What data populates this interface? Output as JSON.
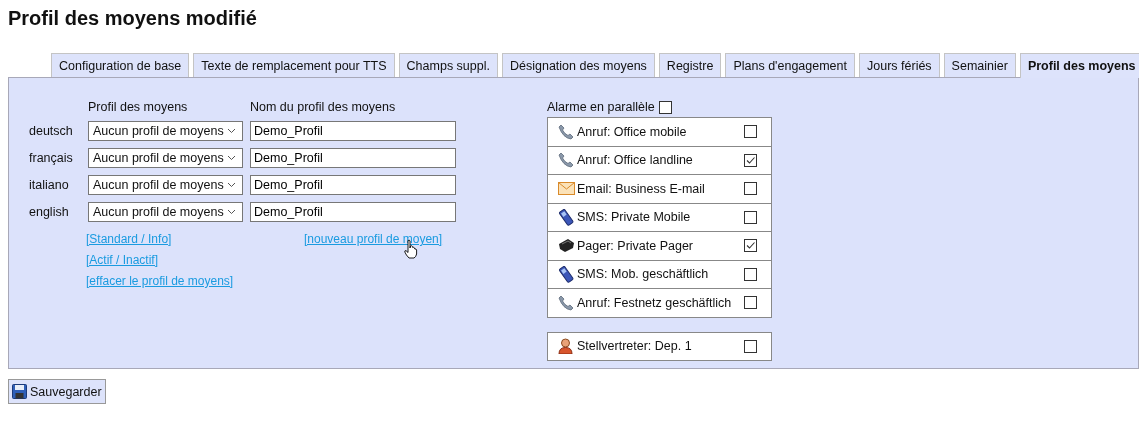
{
  "title": "Profil des moyens modifié",
  "tabs": [
    {
      "label": "Configuration de base",
      "selected": false
    },
    {
      "label": "Texte de remplacement pour TTS",
      "selected": false
    },
    {
      "label": "Champs suppl.",
      "selected": false
    },
    {
      "label": "Désignation des moyens",
      "selected": false
    },
    {
      "label": "Registre",
      "selected": false
    },
    {
      "label": "Plans d'engagement",
      "selected": false
    },
    {
      "label": "Jours fériés",
      "selected": false
    },
    {
      "label": "Semainier",
      "selected": false
    },
    {
      "label": "Profil des moyens",
      "selected": true
    }
  ],
  "profiles": {
    "column_headers": [
      "Profil des moyens",
      "Nom du profil des moyens"
    ],
    "rows": [
      {
        "language": "deutsch",
        "profile": "Aucun profil de moyens",
        "name": "Demo_Profil"
      },
      {
        "language": "français",
        "profile": "Aucun profil de moyens",
        "name": "Demo_Profil"
      },
      {
        "language": "italiano",
        "profile": "Aucun profil de moyens",
        "name": "Demo_Profil"
      },
      {
        "language": "english",
        "profile": "Aucun profil de moyens",
        "name": "Demo_Profil"
      }
    ],
    "left_links": [
      "[Standard / Info]",
      "[Actif / Inactif]",
      "[effacer le profil de moyens]"
    ],
    "new_link": "[nouveau profil de moyen]"
  },
  "parallel_alarm": {
    "label": "Alarme en parallèle",
    "checked": false
  },
  "media": [
    {
      "kind": "phone",
      "label": "Anruf: Office mobile",
      "checked": false
    },
    {
      "kind": "phone",
      "label": "Anruf: Office landline",
      "checked": true
    },
    {
      "kind": "email",
      "label": "Email: Business E-mail",
      "checked": false
    },
    {
      "kind": "mobile",
      "label": "SMS: Private Mobile",
      "checked": false
    },
    {
      "kind": "pager",
      "label": "Pager: Private Pager",
      "checked": true
    },
    {
      "kind": "mobile",
      "label": "SMS: Mob. geschäftlich",
      "checked": false
    },
    {
      "kind": "phone",
      "label": "Anruf: Festnetz geschäftlich",
      "checked": false
    }
  ],
  "deputies": [
    {
      "kind": "person",
      "label": "Stellvertreter: Dep. 1",
      "checked": false
    }
  ],
  "save_button": "Sauvegarder"
}
